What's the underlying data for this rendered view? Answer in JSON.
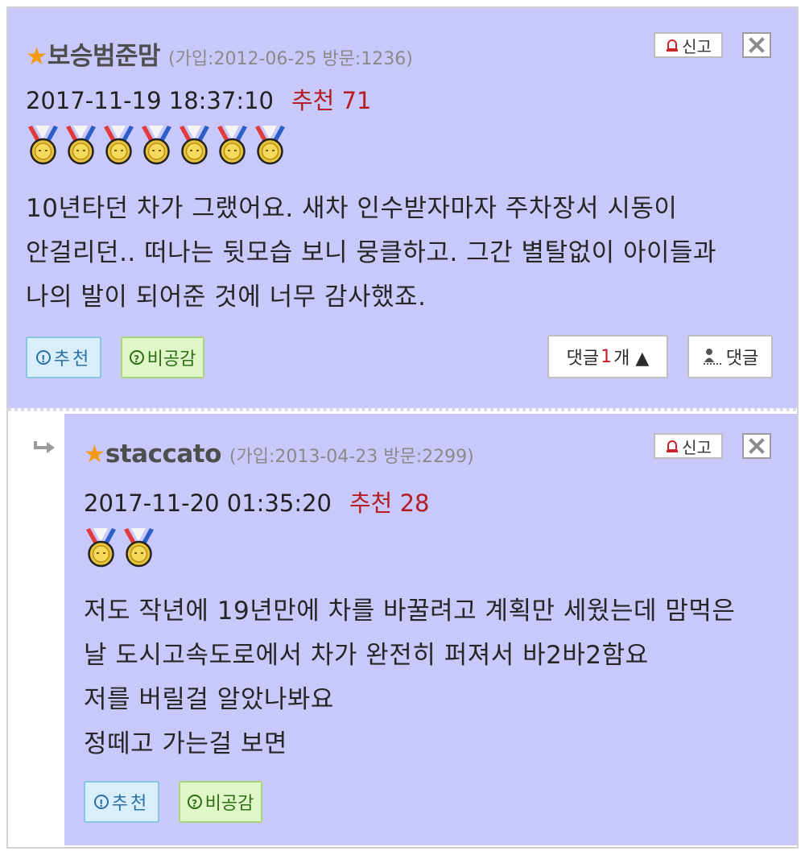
{
  "comments": [
    {
      "star": "★",
      "nickname": "보승범준맘",
      "meta": "(가입:2012-06-25 방문:1236)",
      "datetime": "2017-11-19 18:37:10",
      "recommend": "추천 71",
      "medal_count": 7,
      "body_lines": [
        "10년타던 차가 그랬어요. 새차 인수받자마자 주차장서 시동이",
        "안걸리던.. 떠나는 뒷모습 보니 뭉클하고. 그간 별탈없이 아이들과",
        "나의 발이 되어준 것에 너무 감사했죠."
      ],
      "recommend_button": "추천",
      "unlike_button": "비공감",
      "replies_prefix": "댓글 ",
      "replies_count": "1",
      "replies_suffix": "개 ▲",
      "reply_button": "댓글",
      "report_button": "신고"
    },
    {
      "star": "★",
      "nickname": "staccato",
      "meta": "(가입:2013-04-23 방문:2299)",
      "datetime": "2017-11-20 01:35:20",
      "recommend": "추천 28",
      "medal_count": 2,
      "body_lines": [
        "저도 작년에 19년만에 차를 바꿀려고 계획만 세웠는데 맘먹은",
        "날 도시고속도로에서 차가 완전히 퍼져서 바2바2함요",
        "저를 버릴걸 알았나봐요",
        "정떼고 가는걸 보면"
      ],
      "recommend_button": "추천",
      "unlike_button": "비공감",
      "report_button": "신고"
    }
  ],
  "icons": {
    "medal": "medal-icon",
    "report": "siren-icon",
    "close": "close-icon",
    "reply": "reply-arrow-icon",
    "info": "exclamation-circle-icon",
    "question": "question-circle-icon"
  },
  "colors": {
    "comment_bg": "#c8c8fa",
    "nickname_star": "#f39a14",
    "recommend_text": "#b31d26"
  }
}
